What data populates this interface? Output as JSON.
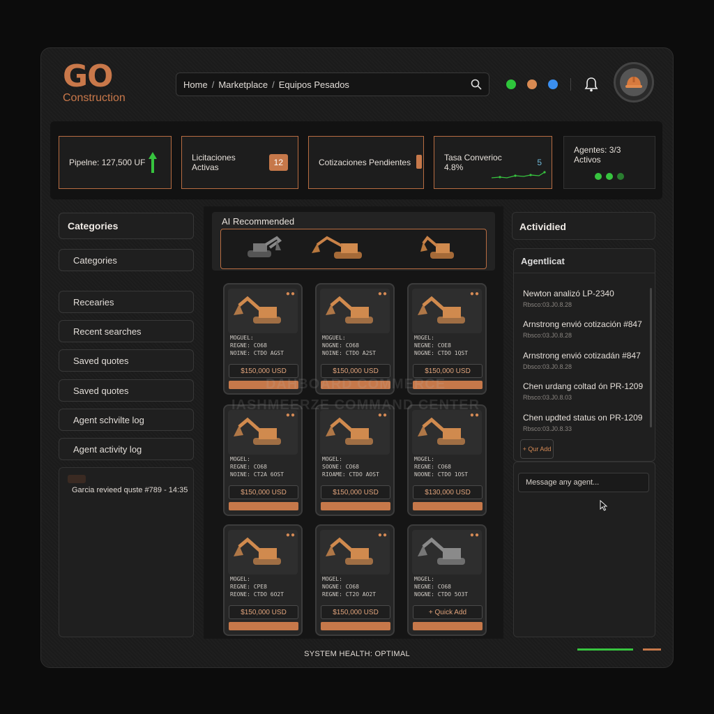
{
  "brand": {
    "logo": "GO",
    "subtitle": "Construction",
    "accent": "#c6784a"
  },
  "breadcrumb": [
    "Home",
    "Marketplace",
    "Equipos Pesados"
  ],
  "status_dots": [
    "#2ec53b",
    "#d98a52",
    "#3a8ff0"
  ],
  "kpis": {
    "pipeline": "Pipelne: 127,500 UF",
    "licitaciones": "Licitaciones Activas",
    "licitaciones_count": "12",
    "cotizaciones": "Cotizaciones Pendientes",
    "conversion": "Tasa Converioc 4.8%",
    "conversion_value": "5",
    "agentes": "Agentes: 3/3 Activos"
  },
  "sidebar": {
    "title": "Categories",
    "items": [
      "Categories",
      "Recearies",
      "Recent searches",
      "Saved quotes",
      "Saved quotes",
      "Agent schvilte log",
      "Agent activity log"
    ],
    "log_entry": "Garcia revieed quste #789 - 14:35"
  },
  "ai": {
    "title": "AI Recommended"
  },
  "cards": [
    {
      "spec": [
        "MOGUEL:",
        "REGNE: CO68",
        "NOINE: CTDO AGST"
      ],
      "price": "$150,000 USD"
    },
    {
      "spec": [
        "MOGUEL:",
        "NOGNE: CO68",
        "NOINE: CTDO A2ST"
      ],
      "price": "$150,000 USD"
    },
    {
      "spec": [
        "MOGEL:",
        "NEGNE: COE8",
        "NOGNE: CTDO 1QST"
      ],
      "price": "$150,000 USD"
    },
    {
      "spec": [
        "MOGEL:",
        "REGNE: CO68",
        "NOINE: CT2A 6OST"
      ],
      "price": "$150,000 USD"
    },
    {
      "spec": [
        "MOGEL:",
        "SOONE: CO68",
        "RIOAME: CTDO AOST"
      ],
      "price": "$150,000 USD"
    },
    {
      "spec": [
        "MOGEL:",
        "REGNE: CO68",
        "NOONE: CTDO 1OST"
      ],
      "price": "$130,000 USD"
    },
    {
      "spec": [
        "MOGEL:",
        "REGNE: CPE8",
        "REONE: CTDO 6O2T"
      ],
      "price": "$150,000 USD"
    },
    {
      "spec": [
        "MOGEL:",
        "NOGNE: CO68",
        "REGNE: CT2O AO2T"
      ],
      "price": "$150,000 USD"
    },
    {
      "spec": [
        "MOGEL:",
        "NEGNE: CO68",
        "NOGNE: CTDO 5O3T"
      ],
      "price": "+ Quick Add"
    }
  ],
  "watermark": [
    "DAHBOARD  COMMERCE",
    "IASHMEERZE COMMAND CENTER"
  ],
  "activity": {
    "title": "Actividied",
    "subtitle": "Agentlicat",
    "items": [
      {
        "text": "Newton analizó LP-2340",
        "meta": "Rbsco:03.J0.8.28"
      },
      {
        "text": "Arnstrong envió cotización #847",
        "meta": "Rbsco:03.J0.8.28"
      },
      {
        "text": "Arnstrong envió cotizadán #847",
        "meta": "Dbsco:03.J0.8.28"
      },
      {
        "text": "Chen urdang coltad ón PR-1209",
        "meta": "Rbsco:03.J0.8.03"
      },
      {
        "text": "Chen updted status on PR-1209",
        "meta": "Rbsco:03.J0.8.33"
      }
    ],
    "quick_add": "+ Qur Add",
    "message_placeholder": "Message any agent..."
  },
  "footer": "SYSTEM HEALTH: OPTIMAL"
}
